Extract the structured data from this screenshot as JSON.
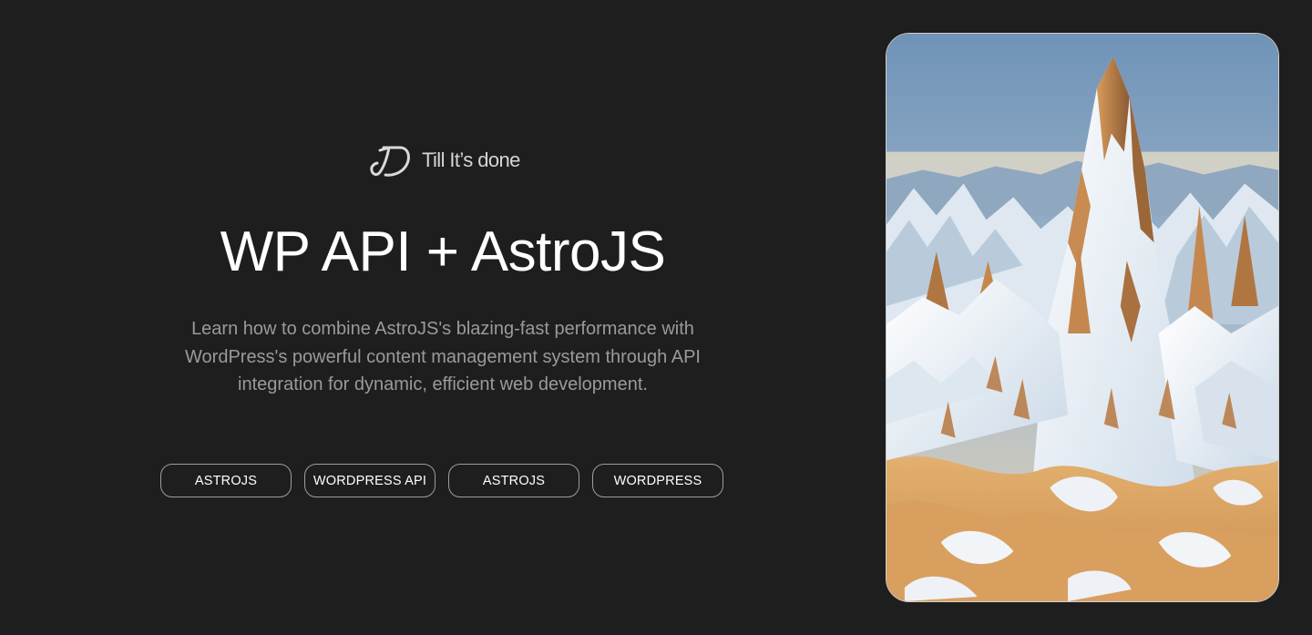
{
  "brand": {
    "name": "Till It’s done",
    "logo_icon": "td-monogram-icon"
  },
  "hero": {
    "title": "WP API + AstroJS",
    "description": "Learn how to combine AstroJS's blazing-fast performance with WordPress's powerful content management system through API integration for dynamic, efficient web development."
  },
  "tags": [
    {
      "label": "ASTROJS"
    },
    {
      "label": "WORDPRESS API"
    },
    {
      "label": "ASTROJS"
    },
    {
      "label": "WORDPRESS"
    }
  ],
  "featured_image": {
    "subject": "snowy-mountain-peaks-illustration"
  },
  "colors": {
    "background": "#1e1e1e",
    "text_primary": "#ffffff",
    "text_muted": "#9a9a9a",
    "tag_border": "#9d9d9d"
  }
}
